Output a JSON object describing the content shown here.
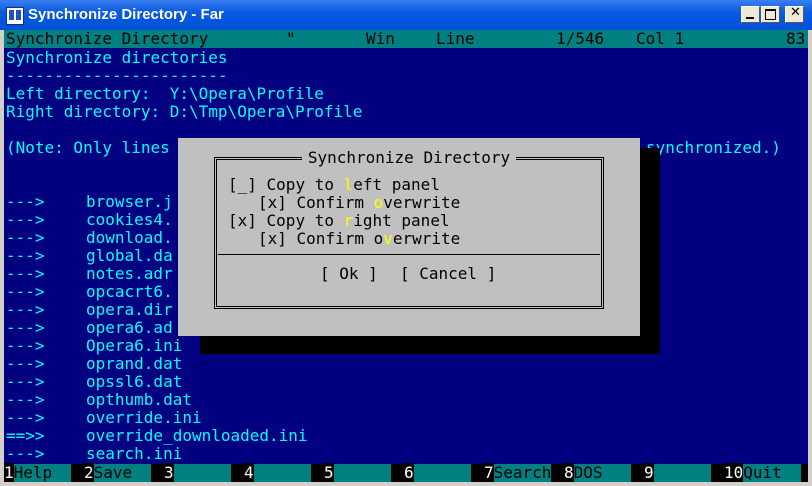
{
  "window": {
    "title": "Synchronize Directory - Far"
  },
  "status": {
    "filename": "Synchronize Directory",
    "modified": "\"",
    "encoding": "Win",
    "line_label": "Line",
    "position": "1/546",
    "col": "Col 1",
    "char": "83"
  },
  "editor": {
    "heading": "Synchronize directories",
    "underline": "-----------------------",
    "left_dir": "Left directory:  Y:\\Opera\\Profile",
    "right_dir": "Right directory: D:\\Tmp\\Opera\\Profile",
    "note_left": "(Note: Only lines",
    "note_right": "synchronized.)",
    "rows": [
      {
        "arrow": "--->",
        "file": "browser.j"
      },
      {
        "arrow": "--->",
        "file": "cookies4."
      },
      {
        "arrow": "--->",
        "file": "download."
      },
      {
        "arrow": "--->",
        "file": "global.da"
      },
      {
        "arrow": "--->",
        "file": "notes.adr"
      },
      {
        "arrow": "--->",
        "file": "opcacrt6."
      },
      {
        "arrow": "--->",
        "file": "opera.dir"
      },
      {
        "arrow": "--->",
        "file": "opera6.ad"
      },
      {
        "arrow": "--->",
        "file": "Opera6.ini"
      },
      {
        "arrow": "--->",
        "file": "oprand.dat"
      },
      {
        "arrow": "--->",
        "file": "opssl6.dat"
      },
      {
        "arrow": "--->",
        "file": "opthumb.dat"
      },
      {
        "arrow": "--->",
        "file": "override.ini"
      },
      {
        "arrow": "==>>",
        "file": "override_downloaded.ini"
      },
      {
        "arrow": "--->",
        "file": "search.ini"
      }
    ]
  },
  "dialog": {
    "title": "Synchronize Directory",
    "copy_left": {
      "box": "[_]",
      "pre": " Copy to ",
      "hot": "l",
      "post": "eft panel"
    },
    "confirm1": {
      "box": "[x]",
      "pre": " Confirm ",
      "hot": "o",
      "post": "verwrite"
    },
    "copy_right": {
      "box": "[x]",
      "pre": " Copy to ",
      "hot": "r",
      "post": "ight panel"
    },
    "confirm2": {
      "box": "[x]",
      "pre": " Confirm o",
      "hot": "v",
      "post": "erwrite"
    },
    "ok": "[ Ok ]",
    "cancel": "[ Cancel ]"
  },
  "keybar": [
    {
      "num": "1",
      "label": "Help  "
    },
    {
      "num": "2",
      "label": "Save  "
    },
    {
      "num": "3",
      "label": "      "
    },
    {
      "num": "4",
      "label": "      "
    },
    {
      "num": "5",
      "label": "      "
    },
    {
      "num": "6",
      "label": "      "
    },
    {
      "num": "7",
      "label": "Search"
    },
    {
      "num": "8",
      "label": "DOS   "
    },
    {
      "num": "9",
      "label": "      "
    },
    {
      "num": "10",
      "label": "Quit  "
    }
  ]
}
